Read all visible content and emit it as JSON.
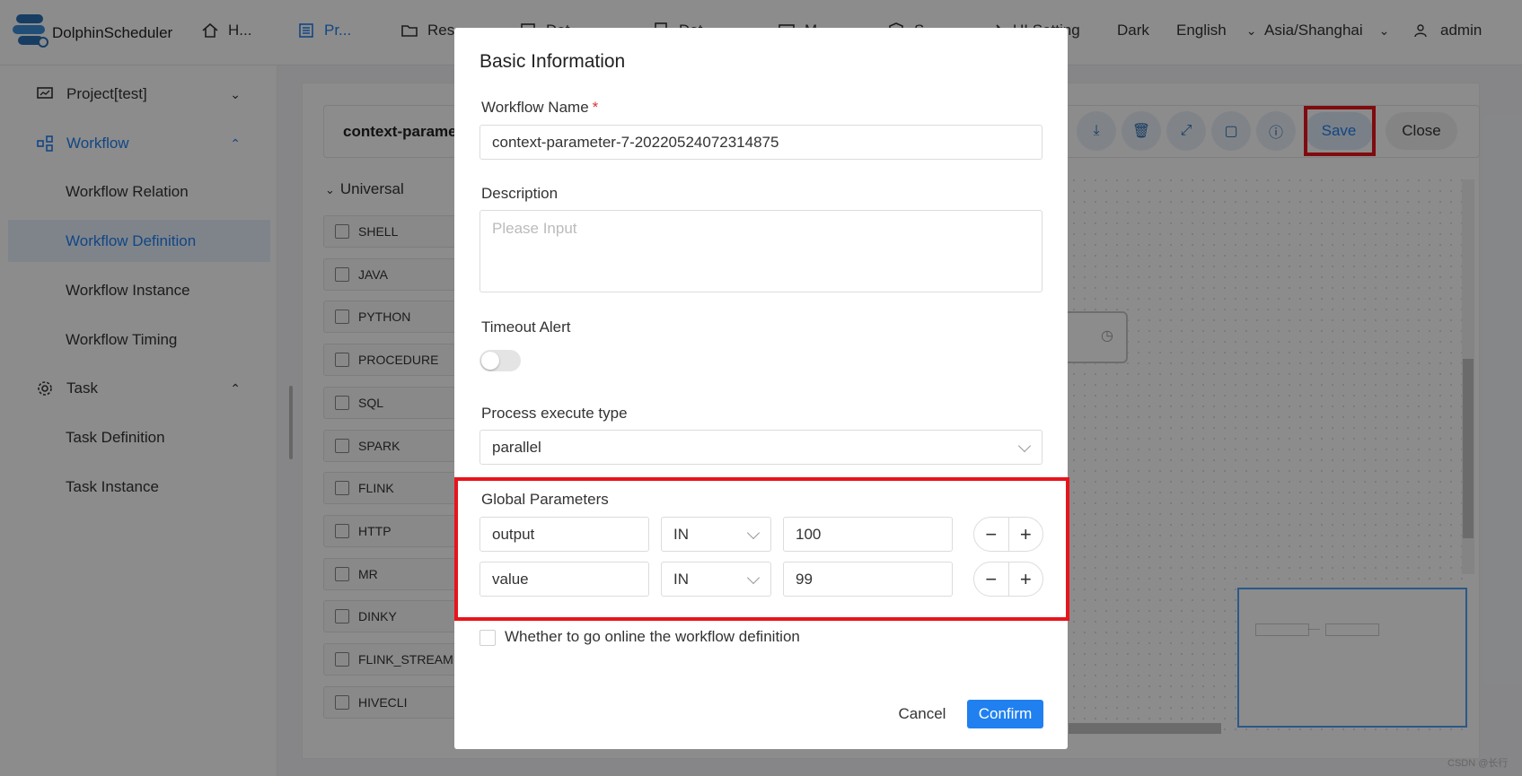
{
  "app": {
    "brand": "DolphinScheduler"
  },
  "header": {
    "nav": [
      {
        "label": "H...",
        "icon": "home-icon"
      },
      {
        "label": "Pr...",
        "icon": "project-icon",
        "active": true
      },
      {
        "label": "Res",
        "icon": "folder-icon"
      },
      {
        "label": "Dat",
        "icon": "datasource-icon"
      },
      {
        "label": "Dat",
        "icon": "data-quality-icon"
      },
      {
        "label": "M...",
        "icon": "monitor-icon"
      },
      {
        "label": "S...",
        "icon": "security-icon"
      },
      {
        "label": "UI Setting",
        "icon": "ui-setting-icon"
      }
    ],
    "theme": "Dark",
    "language": "English",
    "timezone": "Asia/Shanghai",
    "user": "admin"
  },
  "sidebar": {
    "project": "Project[test]",
    "workflow": "Workflow",
    "workflow_items": [
      "Workflow Relation",
      "Workflow Definition",
      "Workflow Instance",
      "Workflow Timing"
    ],
    "task": "Task",
    "task_items": [
      "Task Definition",
      "Task Instance"
    ]
  },
  "editor": {
    "title": "context-parame",
    "universal": "Universal",
    "task_types": [
      "SHELL",
      "JAVA",
      "PYTHON",
      "PROCEDURE",
      "SQL",
      "SPARK",
      "FLINK",
      "HTTP",
      "MR",
      "DINKY",
      "FLINK_STREAM",
      "HIVECLI"
    ],
    "save": "Save",
    "close": "Close",
    "toolbar_icons": [
      "download-icon",
      "delete-icon",
      "fullscreen-icon",
      "format-icon",
      "info-icon"
    ]
  },
  "dialog": {
    "title": "Basic Information",
    "name_label": "Workflow Name",
    "name_required": "*",
    "name_value": "context-parameter-7-20220524072314875",
    "description_label": "Description",
    "description_placeholder": "Please Input",
    "timeout_label": "Timeout Alert",
    "timeout_enabled": false,
    "exec_type_label": "Process execute type",
    "exec_type_value": "parallel",
    "global_params_label": "Global Parameters",
    "global_params": [
      {
        "prop": "output",
        "direct": "IN",
        "value": "100"
      },
      {
        "prop": "value",
        "direct": "IN",
        "value": "99"
      }
    ],
    "online_label": "Whether to go online the workflow definition",
    "online_checked": false,
    "cancel": "Cancel",
    "confirm": "Confirm"
  },
  "watermark": "CSDN @长行",
  "colors": {
    "primary": "#2080f0",
    "highlight": "#e8141c",
    "overlay": "rgba(0,0,0,0.45)"
  }
}
